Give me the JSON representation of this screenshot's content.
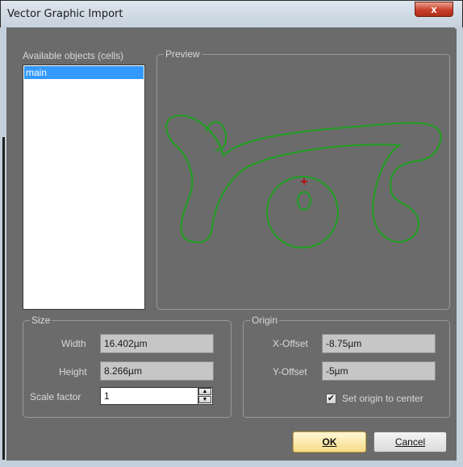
{
  "window": {
    "title": "Vector Graphic Import",
    "close_glyph": "x"
  },
  "objects": {
    "label": "Available objects (cells)",
    "items": [
      {
        "label": "main",
        "selected": true
      }
    ]
  },
  "preview": {
    "label": "Preview",
    "stroke_color": "#1ea01e",
    "origin_color": "#c00000"
  },
  "size": {
    "label": "Size",
    "width_label": "Width",
    "width_value": "16.402µm",
    "height_label": "Height",
    "height_value": "8.266µm",
    "scale_label": "Scale factor",
    "scale_value": "1"
  },
  "origin": {
    "label": "Origin",
    "x_label": "X-Offset",
    "x_value": "-8.75µm",
    "y_label": "Y-Offset",
    "y_value": "-5µm",
    "center_label": "Set origin to center",
    "center_checked": true
  },
  "buttons": {
    "ok": "OK",
    "cancel": "Cancel"
  },
  "colors": {
    "selection": "#3399ff",
    "background": "#6b6b6b"
  }
}
